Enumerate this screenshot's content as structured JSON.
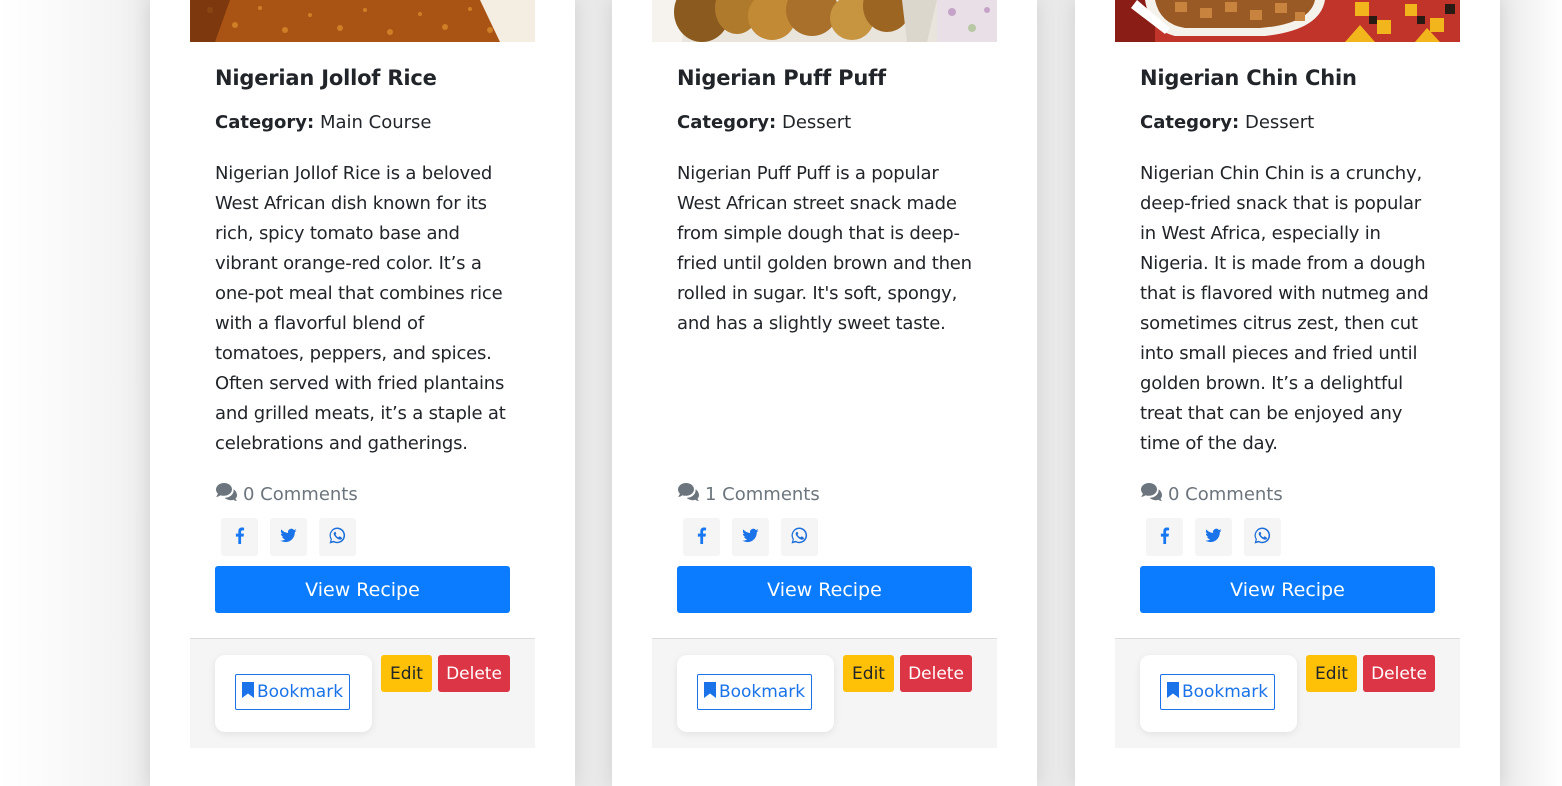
{
  "recipes": [
    {
      "title": "Nigerian Jollof Rice",
      "category_label": "Category:",
      "category": "Main Course",
      "description": "Nigerian Jollof Rice is a beloved West African dish known for its rich, spicy tomato base and vibrant orange-red color. It’s a one-pot meal that combines rice with a flavorful blend of tomatoes, peppers, and spices. Often served with fried plantains and grilled meats, it’s a staple at celebrations and gatherings.",
      "comments": "0 Comments",
      "view_label": "View Recipe",
      "bookmark_label": "Bookmark",
      "edit_label": "Edit",
      "delete_label": "Delete"
    },
    {
      "title": "Nigerian Puff Puff",
      "category_label": "Category:",
      "category": "Dessert",
      "description": "Nigerian Puff Puff is a popular West African street snack made from simple dough that is deep-fried until golden brown and then rolled in sugar. It's soft, spongy, and has a slightly sweet taste.",
      "comments": "1 Comments",
      "view_label": "View Recipe",
      "bookmark_label": "Bookmark",
      "edit_label": "Edit",
      "delete_label": "Delete"
    },
    {
      "title": "Nigerian Chin Chin",
      "category_label": "Category:",
      "category": "Dessert",
      "description": "Nigerian Chin Chin is a crunchy, deep-fried snack that is popular in West Africa, especially in Nigeria. It is made from a dough that is flavored with nutmeg and sometimes citrus zest, then cut into small pieces and fried until golden brown. It’s a delightful treat that can be enjoyed any time of the day.",
      "comments": "0 Comments",
      "view_label": "View Recipe",
      "bookmark_label": "Bookmark",
      "edit_label": "Edit",
      "delete_label": "Delete"
    }
  ],
  "icons": {
    "comments": "comments-icon",
    "share": [
      "facebook-icon",
      "twitter-icon",
      "whatsapp-icon"
    ],
    "bookmark": "bookmark-icon"
  },
  "colors": {
    "primary": "#0b7bff",
    "warning": "#ffc107",
    "danger": "#dc3545",
    "muted": "#6c757d"
  }
}
